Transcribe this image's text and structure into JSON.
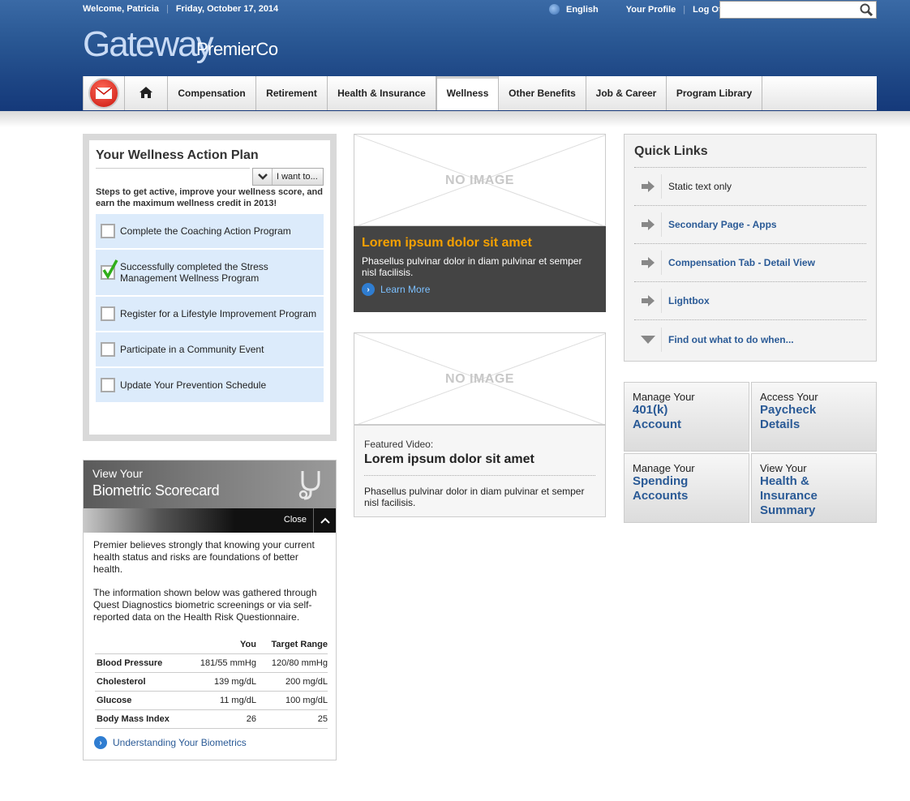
{
  "header": {
    "welcome": "Welcome, Patricia",
    "date": "Friday, October 17, 2014",
    "language": "English",
    "profile": "Your Profile",
    "logoff": "Log Off",
    "logo_main": "Gateway",
    "logo_sub": "PremierCo",
    "search_value": ""
  },
  "nav": {
    "tabs": [
      "Compensation",
      "Retirement",
      "Health & Insurance",
      "Wellness",
      "Other Benefits",
      "Job & Career",
      "Program Library"
    ],
    "active": "Wellness"
  },
  "wellness": {
    "title": "Your Wellness Action Plan",
    "iwant": "I want to...",
    "intro": "Steps to get active, improve your wellness score, and earn the maximum wellness credit in 2013!",
    "steps": [
      {
        "label": "Complete the Coaching Action Program",
        "checked": false
      },
      {
        "label": "Successfully completed the Stress Management Wellness Program",
        "checked": true
      },
      {
        "label": "Register for a Lifestyle Improvement Program",
        "checked": false
      },
      {
        "label": "Participate in a Community Event",
        "checked": false
      },
      {
        "label": "Update Your Prevention Schedule",
        "checked": false
      }
    ]
  },
  "biometric": {
    "title1": "View Your",
    "title2": "Biometric Scorecard",
    "close": "Close",
    "para1": "Premier believes strongly that knowing your current health status and risks are foundations of better health.",
    "para2": "The information shown below was gathered through Quest Diagnostics biometric screenings or via self-reported data on the Health Risk Questionnaire.",
    "col_you": "You",
    "col_target": "Target Range",
    "rows": [
      {
        "label": "Blood Pressure",
        "you": "181/55 mmHg",
        "target": "120/80 mmHg"
      },
      {
        "label": "Cholesterol",
        "you": "139 mg/dL",
        "target": "200 mg/dL"
      },
      {
        "label": "Glucose",
        "you": "11 mg/dL",
        "target": "100 mg/dL"
      },
      {
        "label": "Body Mass Index",
        "you": "26",
        "target": "25"
      }
    ],
    "link": "Understanding Your Biometrics"
  },
  "feature": {
    "no_image": "NO IMAGE",
    "title": "Lorem ipsum dolor sit amet",
    "text": "Phasellus pulvinar dolor in diam pulvinar et semper nisl facilisis.",
    "learn_more": "Learn More",
    "title_color": "#f5a000"
  },
  "video": {
    "no_image": "NO IMAGE",
    "label": "Featured Video:",
    "title": "Lorem ipsum dolor sit amet",
    "text": "Phasellus pulvinar dolor in diam pulvinar et semper nisl facilisis."
  },
  "quick_links": {
    "title": "Quick Links",
    "items": [
      {
        "label": "Static text only",
        "icon": "arrow-right-icon",
        "static": true
      },
      {
        "label": "Secondary Page - Apps",
        "icon": "arrow-right-icon",
        "static": false
      },
      {
        "label": "Compensation Tab - Detail View",
        "icon": "arrow-right-icon",
        "static": false
      },
      {
        "label": "Lightbox",
        "icon": "arrow-right-icon",
        "static": false
      },
      {
        "label": "Find out what to do when...",
        "icon": "chevron-down-icon",
        "static": false
      }
    ]
  },
  "tiles": [
    {
      "line1": "Manage Your",
      "line2": "401(k)",
      "line3": "Account"
    },
    {
      "line1": "Access Your",
      "line2": "Paycheck",
      "line3": "Details"
    },
    {
      "line1": "Manage Your",
      "line2": "Spending",
      "line3": "Accounts"
    },
    {
      "line1": "View Your",
      "line2": "Health &",
      "line3": "Insurance",
      "line4": "Summary"
    }
  ],
  "colors": {
    "brand_blue": "#1c4483",
    "link_blue": "#2a5a96",
    "step_bg": "#dcebfb"
  }
}
